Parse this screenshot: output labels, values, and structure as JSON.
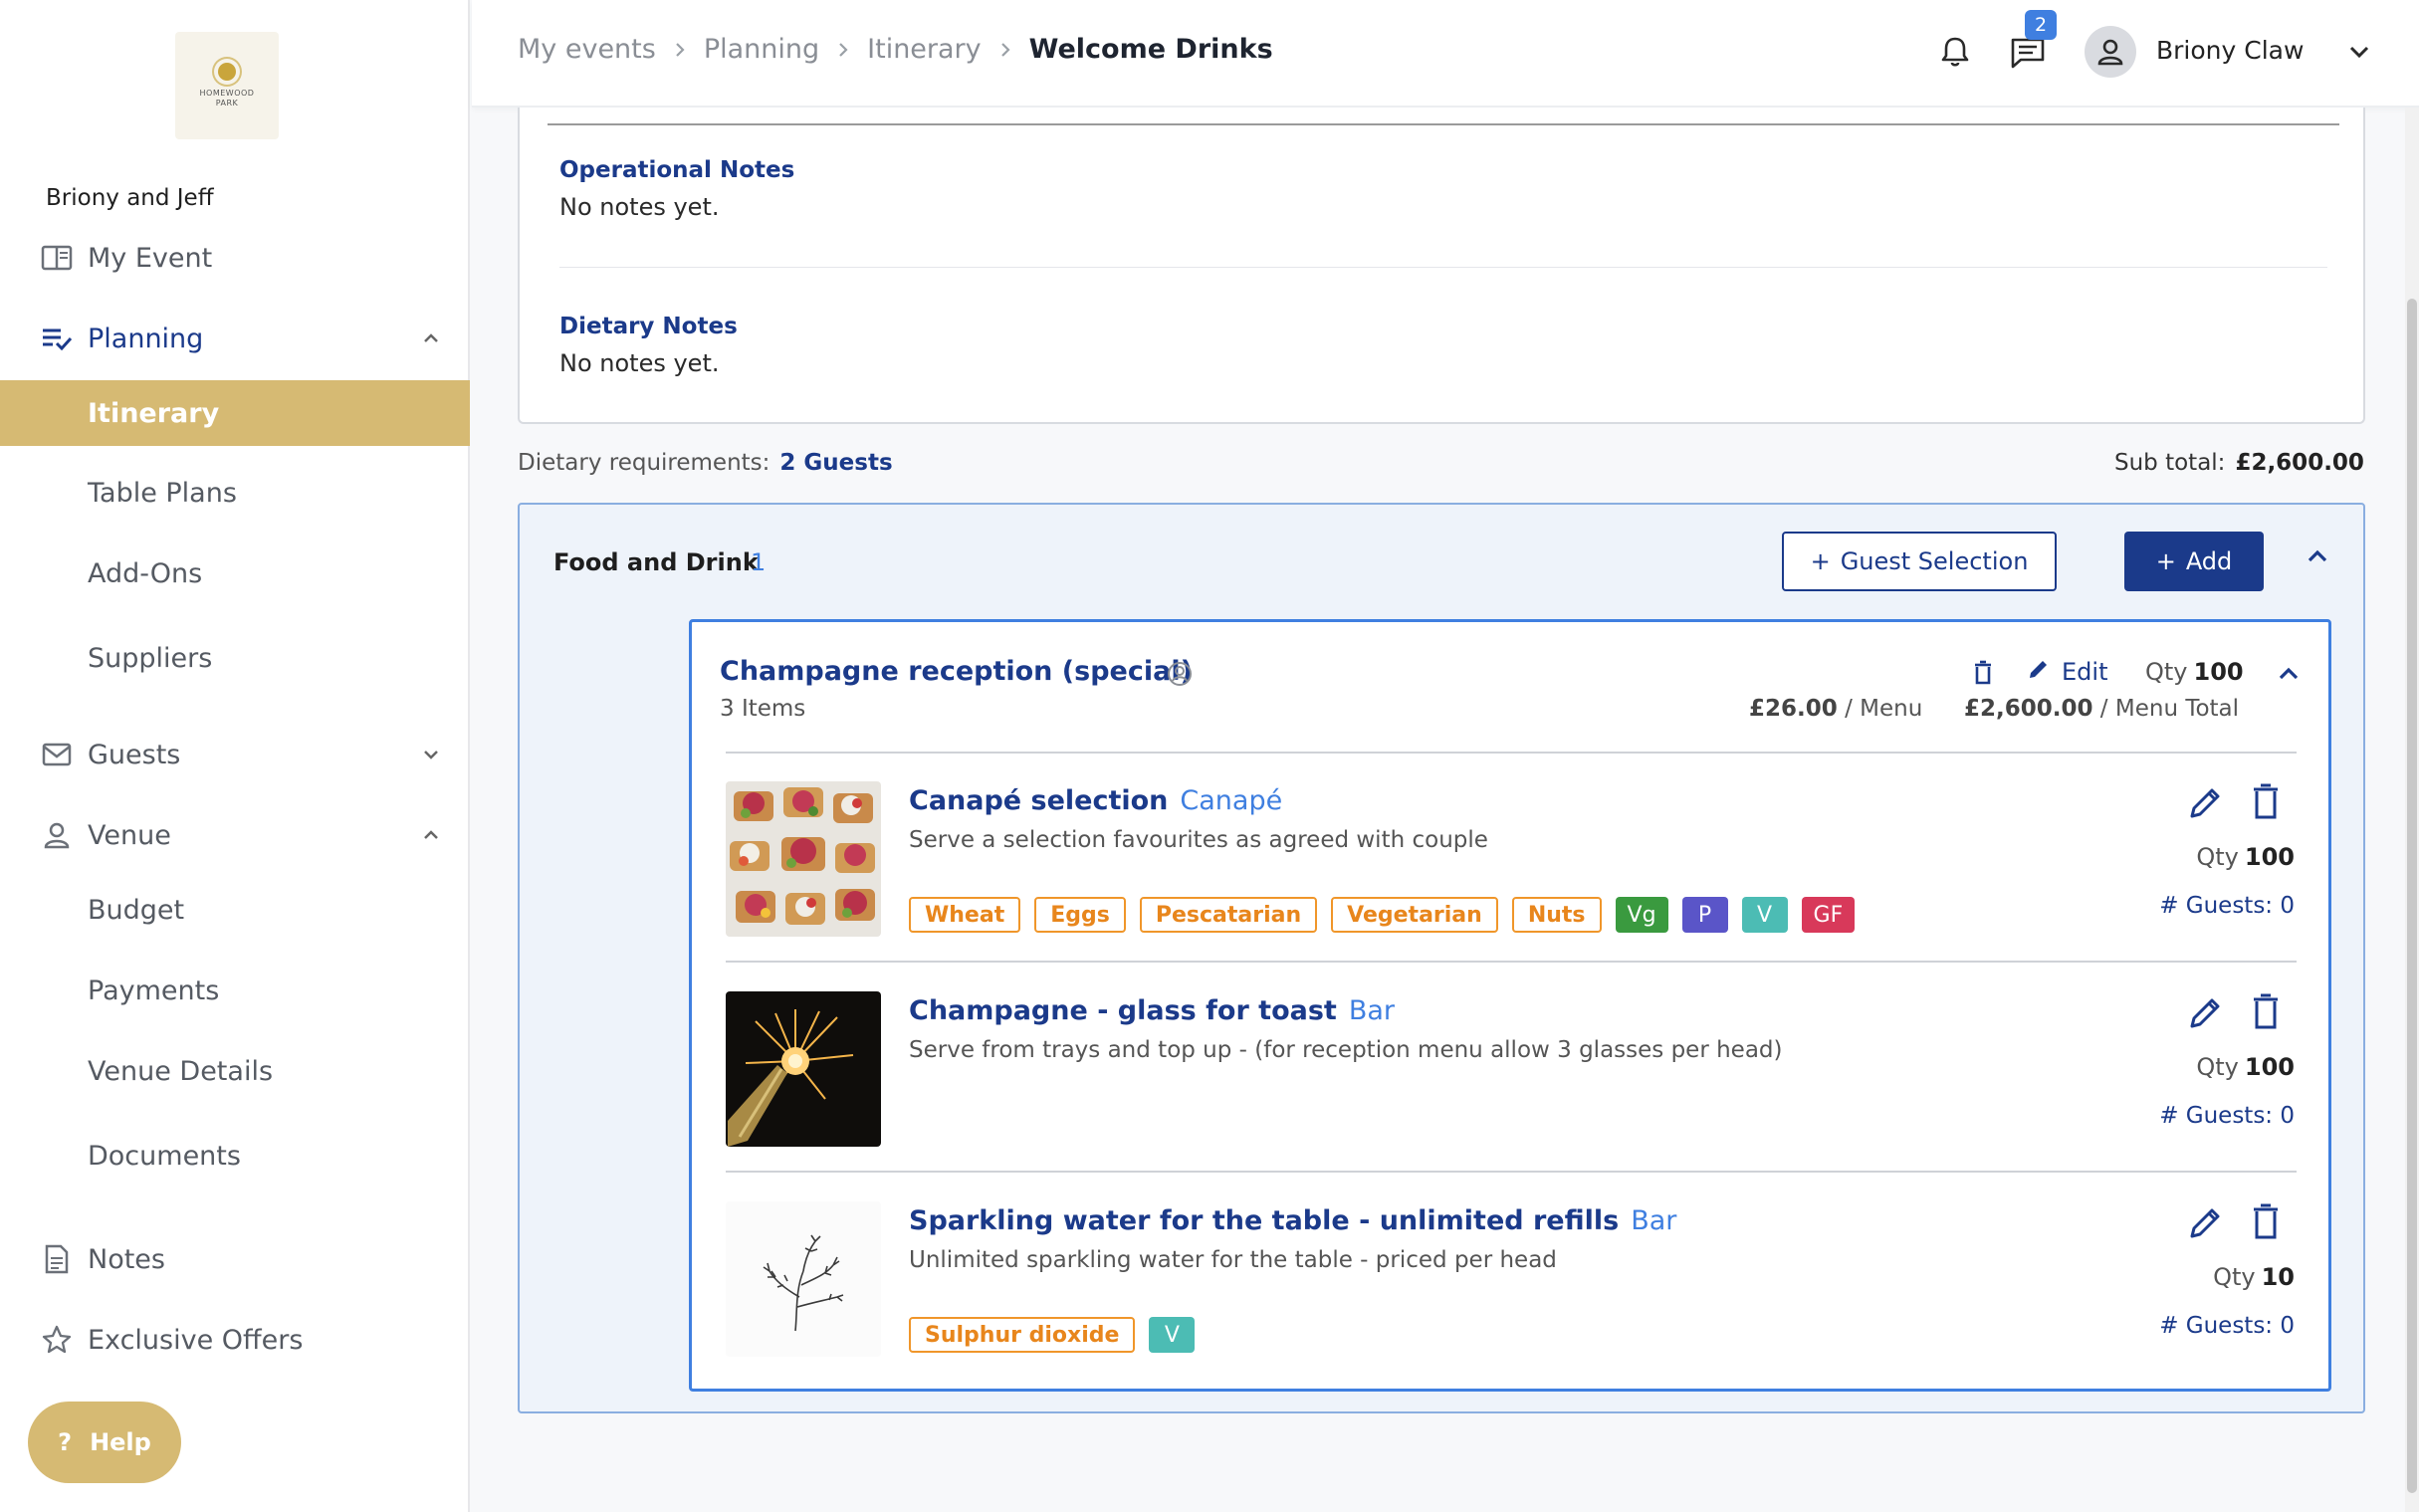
{
  "sidebar": {
    "logo_text": [
      "HOMEWOOD",
      "PARK"
    ],
    "couple_name": "Briony and Jeff",
    "items": {
      "my_event": "My Event",
      "planning": "Planning",
      "itinerary": "Itinerary",
      "table_plans": "Table Plans",
      "add_ons": "Add-Ons",
      "suppliers": "Suppliers",
      "guests": "Guests",
      "venue": "Venue",
      "budget": "Budget",
      "payments": "Payments",
      "venue_details": "Venue Details",
      "documents": "Documents",
      "notes": "Notes",
      "exclusive_offers": "Exclusive Offers"
    },
    "help_label": "Help",
    "accent": "#d6ba73"
  },
  "header": {
    "breadcrumb": [
      "My events",
      "Planning",
      "Itinerary",
      "Welcome Drinks"
    ],
    "notification_count": "2",
    "user_name": "Briony Claw"
  },
  "notes": {
    "operational_title": "Operational Notes",
    "operational_body": "No notes yet.",
    "dietary_title": "Dietary Notes",
    "dietary_body": "No notes yet."
  },
  "summary": {
    "dietary_label": "Dietary requirements:",
    "dietary_value": "2 Guests",
    "subtotal_label": "Sub total:",
    "subtotal_value": "£2,600.00"
  },
  "food_and_drink": {
    "title": "Food and Drink",
    "count": "1",
    "guest_selection_label": "Guest Selection",
    "add_label": "Add",
    "menu": {
      "title": "Champagne reception (special)",
      "items_count": "3 Items",
      "edit_label": "Edit",
      "qty_label": "Qty",
      "qty_value": "100",
      "price": "£26.00",
      "price_unit": " / Menu",
      "total": "£2,600.00",
      "total_unit": " / Menu Total",
      "items": [
        {
          "name": "Canapé selection",
          "category": "Canapé",
          "description": "Serve a selection favourites as agreed with couple",
          "qty_label": "Qty",
          "qty": "100",
          "guests": "# Guests: 0",
          "tags": [
            "Wheat",
            "Eggs",
            "Pescatarian",
            "Vegetarian",
            "Nuts"
          ],
          "badges": [
            "Vg",
            "P",
            "V",
            "GF"
          ]
        },
        {
          "name": "Champagne - glass for toast",
          "category": "Bar",
          "description": "Serve from trays and top up - (for reception menu allow 3 glasses per head)",
          "qty_label": "Qty",
          "qty": "100",
          "guests": "# Guests: 0"
        },
        {
          "name": "Sparkling water for the table - unlimited refills",
          "category": "Bar",
          "description": "Unlimited sparkling water for the table - priced per head",
          "qty_label": "Qty",
          "qty": "10",
          "guests": "# Guests: 0",
          "tags": [
            "Sulphur dioxide"
          ],
          "badges": [
            "V"
          ]
        }
      ]
    }
  },
  "colors": {
    "primary": "#1b3a8a",
    "link": "#3f7fe0",
    "allergen": "#f0962a",
    "badge_vg": "#3a9a3f",
    "badge_p": "#5a55c8",
    "badge_v": "#4cbcb4",
    "badge_gf": "#d8395a"
  }
}
